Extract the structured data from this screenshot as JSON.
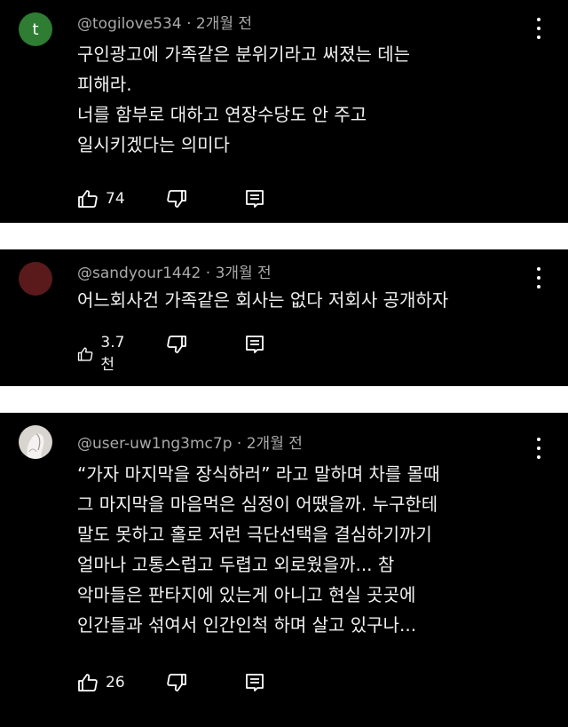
{
  "comments": [
    {
      "avatar_letter": "t",
      "avatar_color": "#2e7d32",
      "username": "@togilove534",
      "time": "2개월 전",
      "lines": [
        "구인광고에 가족같은 분위기라고 써졌는 데는",
        "피해라.",
        "너를 함부로 대하고 연장수당도 안 주고",
        "일시키겠다는 의미다"
      ],
      "likes": "74"
    },
    {
      "avatar_letter": "",
      "avatar_color": "#5a1a1c",
      "username": "@sandyour1442",
      "time": "3개월 전",
      "lines": [
        "어느회사건 가족같은 회사는 없다 저회사 공개하자"
      ],
      "likes": "3.7천"
    },
    {
      "avatar_letter": "",
      "avatar_color": "#d8d4d0",
      "username": "@user-uw1ng3mc7p",
      "time": "2개월 전",
      "lines": [
        "“가자 마지막을 장식하러” 라고 말하며 차를 몰때",
        "그 마지막을 마음먹은 심정이 어땠을까. 누구한테",
        "말도 못하고 홀로 저런 극단선택을 결심하기까기",
        "얼마나 고통스럽고 두렵고 외로웠을까... 참",
        "악마들은 판타지에 있는게 아니고 현실 곳곳에",
        "인간들과 섞여서 인간인척 하며 살고 있구나..."
      ],
      "likes": "26"
    }
  ],
  "separator": "·",
  "icons": {
    "like": "thumbs-up-icon",
    "dislike": "thumbs-down-icon",
    "reply": "reply-icon",
    "more": "more-vert-icon"
  }
}
